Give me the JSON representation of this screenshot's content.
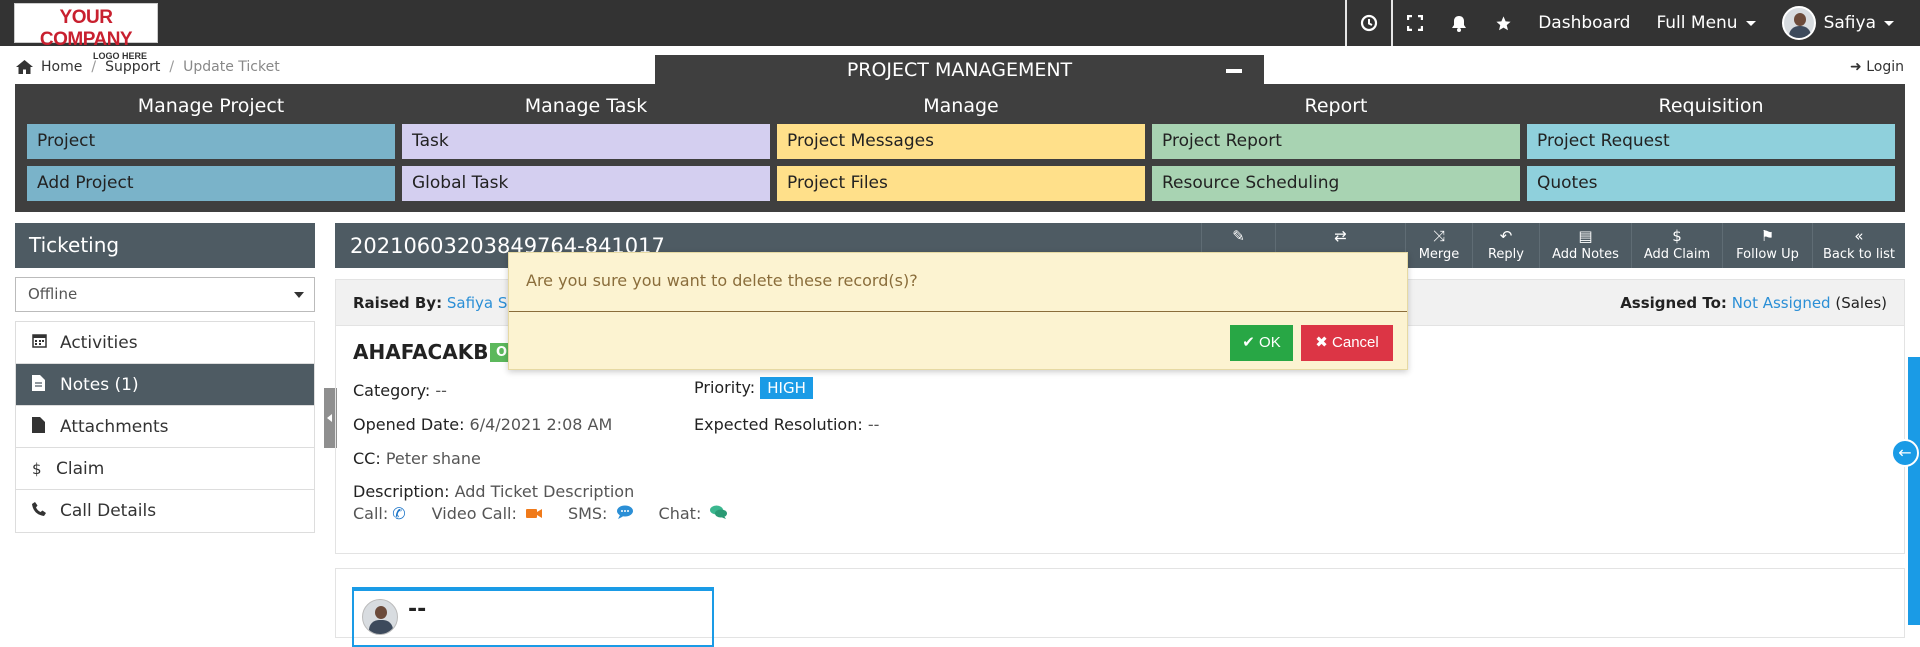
{
  "logo": {
    "line1": "YOUR COMPANY",
    "line2": "LOGO HERE"
  },
  "topbar": {
    "dashboard": "Dashboard",
    "full_menu": "Full Menu",
    "user": "Safiya"
  },
  "breadcrumb": {
    "home": "Home",
    "support": "Support",
    "current": "Update Ticket",
    "sep": "/"
  },
  "login": "Login",
  "pm": {
    "title": "PROJECT MANAGEMENT",
    "columns": [
      {
        "head": "Manage Project",
        "items": [
          "Project",
          "Add Project"
        ],
        "color": "#7ab3c9"
      },
      {
        "head": "Manage Task",
        "items": [
          "Task",
          "Global Task"
        ],
        "color": "#d4cff0"
      },
      {
        "head": "Manage",
        "items": [
          "Project Messages",
          "Project Files"
        ],
        "color": "#ffe08a"
      },
      {
        "head": "Report",
        "items": [
          "Project Report",
          "Resource Scheduling"
        ],
        "color": "#a8d3b2"
      },
      {
        "head": "Requisition",
        "items": [
          "Project Request",
          "Quotes"
        ],
        "color": "#8fd0dc"
      }
    ]
  },
  "sidebar": {
    "title": "Ticketing",
    "status": "Offline",
    "items": [
      {
        "label": "Activities",
        "icon": "calendar-icon"
      },
      {
        "label": "Notes (1)",
        "icon": "file-icon"
      },
      {
        "label": "Attachments",
        "icon": "file-icon"
      },
      {
        "label": "Claim",
        "icon": "dollar-icon"
      },
      {
        "label": "Call Details",
        "icon": "phone-icon"
      }
    ]
  },
  "ticket": {
    "id": "20210603203849764-841017",
    "actions": [
      {
        "label": "",
        "icon": "pencil-icon"
      },
      {
        "label": "",
        "icon": "exchange-icon"
      },
      {
        "label": "Merge",
        "icon": "shuffle-icon"
      },
      {
        "label": "Reply",
        "icon": "reply-icon"
      },
      {
        "label": "Add Notes",
        "icon": "note-icon"
      },
      {
        "label": "Add Claim",
        "icon": "dollar-icon"
      },
      {
        "label": "Follow Up",
        "icon": "flag-icon"
      },
      {
        "label": "Back to list",
        "icon": "double-chevron-left-icon"
      }
    ],
    "raised_by_label": "Raised By:",
    "raised_by": "Safiya Smit",
    "assigned_label": "Assigned To:",
    "assigned_to": "Not Assigned",
    "assigned_group": "(Sales)",
    "name": "AHAFACAKBL",
    "status_short": "O",
    "category_label": "Category:",
    "category": "--",
    "priority_label": "Priority:",
    "priority": "HIGH",
    "opened_label": "Opened Date:",
    "opened": "6/4/2021 2:08 AM",
    "expected_label": "Expected Resolution:",
    "expected": "--",
    "cc_label": "CC:",
    "cc": "Peter shane",
    "desc_label": "Description:",
    "desc": "Add Ticket Description",
    "comm": {
      "call": "Call:",
      "video": "Video Call:",
      "sms": "SMS:",
      "chat": "Chat:"
    }
  },
  "note": {
    "title": "--"
  },
  "dialog": {
    "message": "Are you sure you want to delete these record(s)?",
    "ok": "OK",
    "cancel": "Cancel"
  }
}
